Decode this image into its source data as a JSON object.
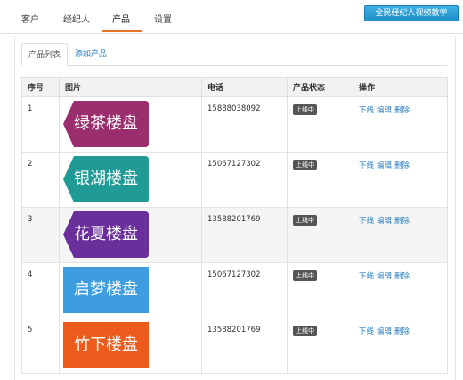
{
  "top_nav": {
    "tabs": [
      "客户",
      "经纪人",
      "产品",
      "设置"
    ],
    "active_tab": "产品",
    "promo_button": "全民经纪人视频教学"
  },
  "sub_tabs": {
    "product_list": "产品列表",
    "add_product": "添加产品"
  },
  "table": {
    "headers": [
      "序号",
      "图片",
      "电话",
      "产品状态",
      "操作"
    ],
    "rows": [
      {
        "index": "1",
        "image_text": "绿茶楼盘",
        "image_color": "#9b2f6e",
        "image_shape": "tag",
        "phone": "15888038092",
        "status": "上线中"
      },
      {
        "index": "2",
        "image_text": "银湖楼盘",
        "image_color": "#1f9a94",
        "image_shape": "tag",
        "phone": "15067127302",
        "status": "上线中"
      },
      {
        "index": "3",
        "image_text": "花夏楼盘",
        "image_color": "#6a2f9a",
        "image_shape": "tag",
        "phone": "13588201769",
        "status": "上线中"
      },
      {
        "index": "4",
        "image_text": "启梦楼盘",
        "image_color": "#3d9de0",
        "image_shape": "rect",
        "phone": "15067127302",
        "status": "上线中"
      },
      {
        "index": "5",
        "image_text": "竹下楼盘",
        "image_color": "#ec5b1c",
        "image_shape": "rect",
        "phone": "13588201769",
        "status": "上线中"
      }
    ],
    "actions": [
      "下线",
      "编辑",
      "删除"
    ]
  }
}
